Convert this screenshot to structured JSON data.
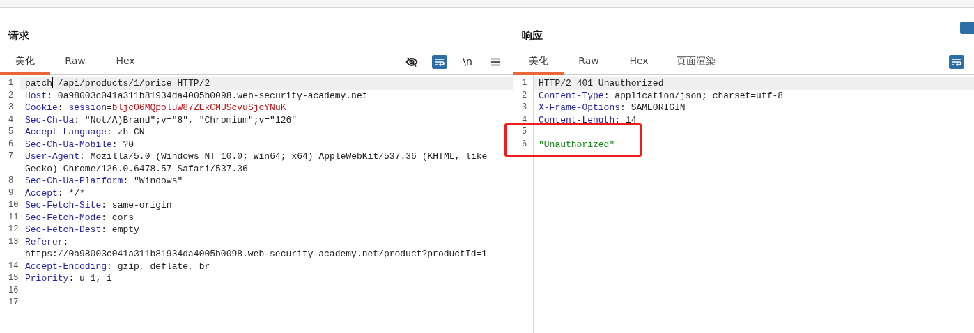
{
  "panels": [
    {
      "title": "请求",
      "tabs": [
        {
          "label": "美化",
          "selected": true
        },
        {
          "label": "Raw",
          "selected": false
        },
        {
          "label": "Hex",
          "selected": false
        }
      ],
      "toolbar": [
        {
          "kind": "eye-off",
          "on": false
        },
        {
          "kind": "wrap",
          "on": true
        },
        {
          "kind": "text",
          "label": "\\n"
        },
        {
          "kind": "menu"
        }
      ],
      "lines": [
        {
          "number": "1",
          "current": true,
          "parts": [
            {
              "kind": "text",
              "text": "patch"
            },
            {
              "kind": "cursor"
            },
            {
              "kind": "text",
              "text": " /api/products/1/price HTTP/2"
            }
          ]
        },
        {
          "number": "2",
          "parts": [
            {
              "kind": "name",
              "text": "Host"
            },
            {
              "kind": "text",
              "text": ": 0a98003c041a311b81934da4005b0098.web-security-academy.net"
            }
          ]
        },
        {
          "number": "3",
          "parts": [
            {
              "kind": "name",
              "text": "Cookie"
            },
            {
              "kind": "text",
              "text": ": "
            },
            {
              "kind": "name",
              "text": "session"
            },
            {
              "kind": "text",
              "text": "="
            },
            {
              "kind": "value",
              "text": "bljcO6MQpoluW87ZEkCMUScvuSjcYNuK"
            }
          ]
        },
        {
          "number": "4",
          "parts": [
            {
              "kind": "name",
              "text": "Sec-Ch-Ua"
            },
            {
              "kind": "text",
              "text": ": \"Not/A)Brand\";v=\"8\", \"Chromium\";v=\"126\""
            }
          ]
        },
        {
          "number": "5",
          "parts": [
            {
              "kind": "name",
              "text": "Accept-Language"
            },
            {
              "kind": "text",
              "text": ": zh-CN"
            }
          ]
        },
        {
          "number": "6",
          "parts": [
            {
              "kind": "name",
              "text": "Sec-Ch-Ua-Mobile"
            },
            {
              "kind": "text",
              "text": ": ?0"
            }
          ]
        },
        {
          "number": "7",
          "parts": [
            {
              "kind": "name",
              "text": "User-Agent"
            },
            {
              "kind": "text",
              "text": ": Mozilla/5.0 (Windows NT 10.0; Win64; x64) AppleWebKit/537.36 (KHTML, like Gecko) Chrome/126.0.6478.57 Safari/537.36"
            }
          ]
        },
        {
          "number": "8",
          "parts": [
            {
              "kind": "name",
              "text": "Sec-Ch-Ua-Platform"
            },
            {
              "kind": "text",
              "text": ": \"Windows\""
            }
          ]
        },
        {
          "number": "9",
          "parts": [
            {
              "kind": "name",
              "text": "Accept"
            },
            {
              "kind": "text",
              "text": ": */*"
            }
          ]
        },
        {
          "number": "10",
          "parts": [
            {
              "kind": "name",
              "text": "Sec-Fetch-Site"
            },
            {
              "kind": "text",
              "text": ": same-origin"
            }
          ]
        },
        {
          "number": "11",
          "parts": [
            {
              "kind": "name",
              "text": "Sec-Fetch-Mode"
            },
            {
              "kind": "text",
              "text": ": cors"
            }
          ]
        },
        {
          "number": "12",
          "parts": [
            {
              "kind": "name",
              "text": "Sec-Fetch-Dest"
            },
            {
              "kind": "text",
              "text": ": empty"
            }
          ]
        },
        {
          "number": "13",
          "parts": [
            {
              "kind": "name",
              "text": "Referer"
            },
            {
              "kind": "text",
              "text": ": https://0a98003c041a311b81934da4005b0098.web-security-academy.net/product?productId=1"
            }
          ]
        },
        {
          "number": "14",
          "parts": [
            {
              "kind": "name",
              "text": "Accept-Encoding"
            },
            {
              "kind": "text",
              "text": ": gzip, deflate, br"
            }
          ]
        },
        {
          "number": "15",
          "parts": [
            {
              "kind": "name",
              "text": "Priority"
            },
            {
              "kind": "text",
              "text": ": u=1, i"
            }
          ]
        },
        {
          "number": "16"
        },
        {
          "number": "17"
        }
      ]
    },
    {
      "title": "响应",
      "tabs": [
        {
          "label": "美化",
          "selected": true
        },
        {
          "label": "Raw",
          "selected": false
        },
        {
          "label": "Hex",
          "selected": false
        },
        {
          "label": "页面渲染",
          "selected": false
        }
      ],
      "toolbar": [
        {
          "kind": "wrap",
          "on": true
        }
      ],
      "lines": [
        {
          "number": "1",
          "current": true,
          "parts": [
            {
              "kind": "text",
              "text": "HTTP/2 401 Unauthorized"
            }
          ]
        },
        {
          "number": "2",
          "parts": [
            {
              "kind": "name",
              "text": "Content-Type"
            },
            {
              "kind": "text",
              "text": ": application/json; charset=utf-8"
            }
          ]
        },
        {
          "number": "3",
          "parts": [
            {
              "kind": "name",
              "text": "X-Frame-Options"
            },
            {
              "kind": "text",
              "text": ": SAMEORIGIN"
            }
          ]
        },
        {
          "number": "4",
          "parts": [
            {
              "kind": "name",
              "text": "Content-Length"
            },
            {
              "kind": "text",
              "text": ": 14"
            }
          ]
        },
        {
          "number": "5",
          "highlighted": true
        },
        {
          "number": "6",
          "highlighted": true,
          "parts": [
            {
              "kind": "string",
              "text": "\"Unauthorized\""
            }
          ]
        }
      ]
    }
  ]
}
